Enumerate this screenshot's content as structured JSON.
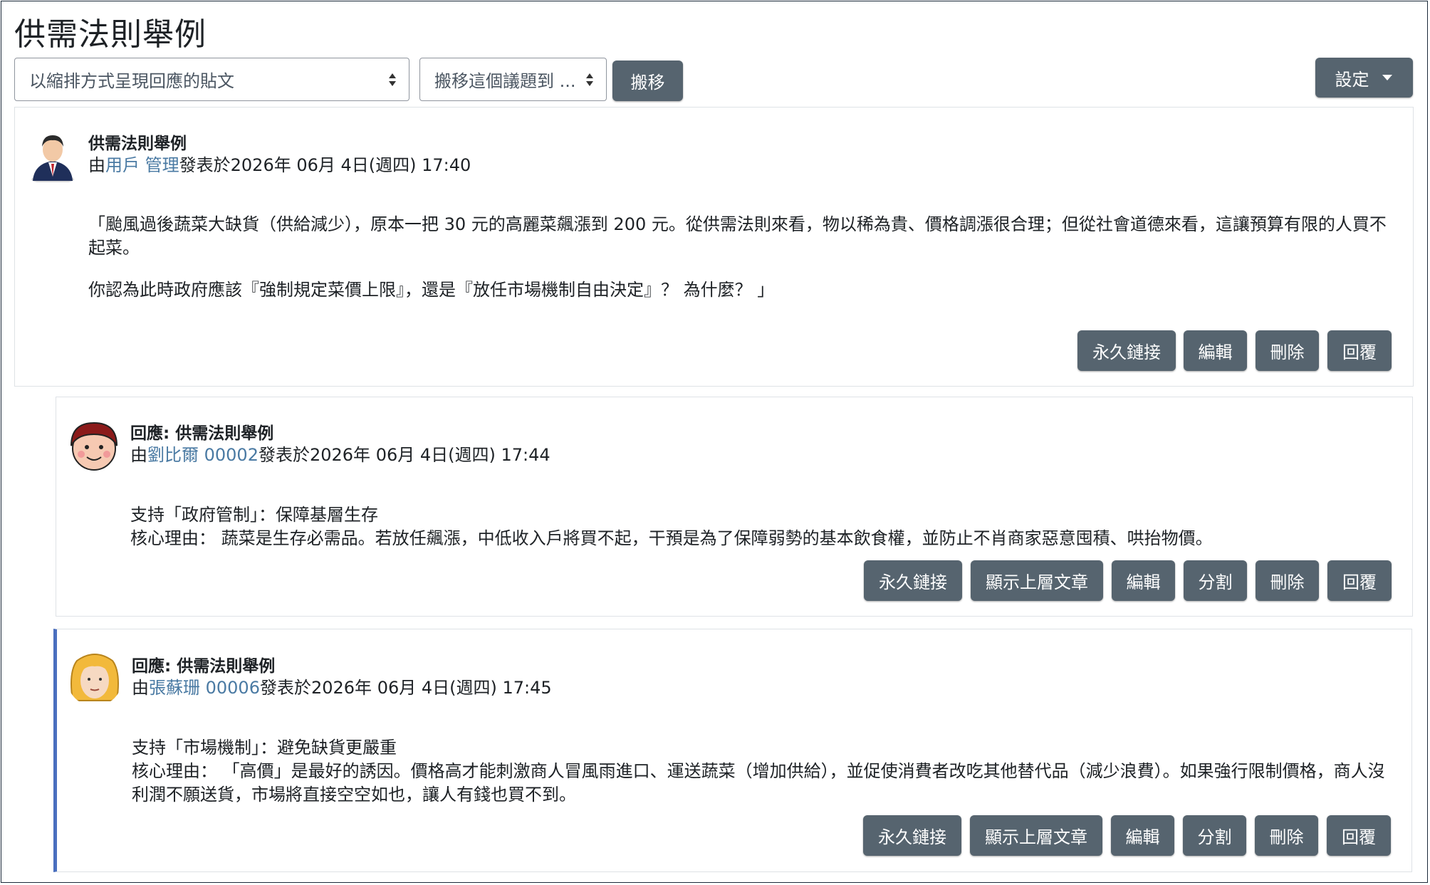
{
  "page": {
    "title": "供需法則舉例"
  },
  "controls": {
    "display_mode": "以縮排方式呈現回應的貼文",
    "move_to": "搬移這個議題到 ...",
    "move_button": "搬移",
    "settings_button": "設定"
  },
  "posts": [
    {
      "subject": "供需法則舉例",
      "by": "由",
      "author": "用戶 管理",
      "posted": "發表於2026年 06月 4日(週四) 17:40",
      "lines": [
        "「颱風過後蔬菜大缺貨（供給減少），原本一把 30 元的高麗菜飆漲到 200 元。從供需法則來看，物以稀為貴、價格調漲很合理；但從社會道德來看，這讓預算有限的人買不起菜。",
        "你認為此時政府應該『強制規定菜價上限』，還是『放任市場機制自由決定』？ 為什麼？ 」"
      ],
      "actions": [
        "永久鏈接",
        "編輯",
        "刪除",
        "回覆"
      ]
    },
    {
      "subject": "回應: 供需法則舉例",
      "by": "由",
      "author": "劉比爾 00002",
      "posted": "發表於2026年 06月 4日(週四) 17:44",
      "lines": [
        "支持「政府管制」：保障基層生存",
        "核心理由： 蔬菜是生存必需品。若放任飆漲，中低收入戶將買不起，干預是為了保障弱勢的基本飲食權，並防止不肖商家惡意囤積、哄抬物價。"
      ],
      "actions": [
        "永久鏈接",
        "顯示上層文章",
        "編輯",
        "分割",
        "刪除",
        "回覆"
      ]
    },
    {
      "subject": "回應: 供需法則舉例",
      "by": "由",
      "author": "張蘇珊 00006",
      "posted": "發表於2026年 06月 4日(週四) 17:45",
      "lines": [
        "支持「市場機制」：避免缺貨更嚴重",
        "核心理由： 「高價」是最好的誘因。價格高才能刺激商人冒風雨進口、運送蔬菜（增加供給），並促使消費者改吃其他替代品（減少浪費）。如果強行限制價格，商人沒利潤不願送貨，市場將直接空空如也，讓人有錢也買不到。"
      ],
      "actions": [
        "永久鏈接",
        "顯示上層文章",
        "編輯",
        "分割",
        "刪除",
        "回覆"
      ]
    }
  ],
  "colors": {
    "button": "#56646f",
    "accent": "#4a6fbf",
    "link": "#4a7aa3"
  }
}
